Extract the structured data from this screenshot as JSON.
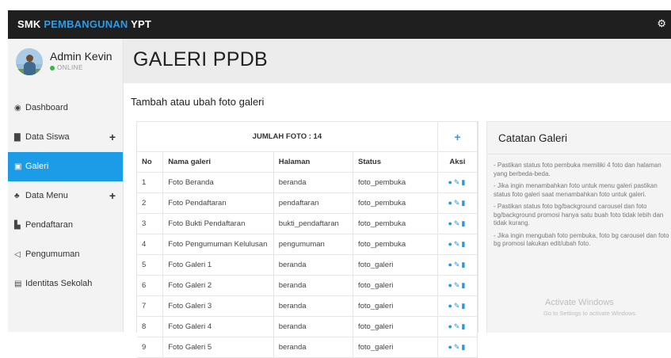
{
  "brand": {
    "part1": "SMK ",
    "part2": "PEMBANGUNAN",
    "part3": " YPT"
  },
  "user": {
    "name": "Admin Kevin",
    "status": "ONLINE"
  },
  "sidebar": {
    "items": [
      {
        "label": "Dashboard",
        "icon": "dashboard-icon",
        "has_plus": false,
        "active": false
      },
      {
        "label": "Data Siswa",
        "icon": "book-icon",
        "has_plus": true,
        "active": false
      },
      {
        "label": "Galeri",
        "icon": "image-icon",
        "has_plus": false,
        "active": true
      },
      {
        "label": "Data Menu",
        "icon": "sitemap-icon",
        "has_plus": true,
        "active": false
      },
      {
        "label": "Pendaftaran",
        "icon": "form-icon",
        "has_plus": false,
        "active": false
      },
      {
        "label": "Pengumuman",
        "icon": "bullhorn-icon",
        "has_plus": false,
        "active": false
      },
      {
        "label": "Identitas Sekolah",
        "icon": "id-card-icon",
        "has_plus": false,
        "active": false
      }
    ]
  },
  "page": {
    "title": "GALERI PPDB",
    "subtitle": "Tambah atau ubah foto galeri"
  },
  "table": {
    "banner": "JUMLAH FOTO : 14",
    "add_symbol": "+",
    "columns": [
      "No",
      "Nama galeri",
      "Halaman",
      "Status",
      "Aksi"
    ],
    "rows": [
      {
        "no": "1",
        "nama": "Foto Beranda",
        "halaman": "beranda",
        "status": "foto_pembuka"
      },
      {
        "no": "2",
        "nama": "Foto Pendaftaran",
        "halaman": "pendaftaran",
        "status": "foto_pembuka"
      },
      {
        "no": "3",
        "nama": "Foto Bukti Pendaftaran",
        "halaman": "bukti_pendaftaran",
        "status": "foto_pembuka"
      },
      {
        "no": "4",
        "nama": "Foto Pengumuman Kelulusan",
        "halaman": "pengumuman",
        "status": "foto_pembuka"
      },
      {
        "no": "5",
        "nama": "Foto Galeri 1",
        "halaman": "beranda",
        "status": "foto_galeri"
      },
      {
        "no": "6",
        "nama": "Foto Galeri 2",
        "halaman": "beranda",
        "status": "foto_galeri"
      },
      {
        "no": "7",
        "nama": "Foto Galeri 3",
        "halaman": "beranda",
        "status": "foto_galeri"
      },
      {
        "no": "8",
        "nama": "Foto Galeri 4",
        "halaman": "beranda",
        "status": "foto_galeri"
      },
      {
        "no": "9",
        "nama": "Foto Galeri 5",
        "halaman": "beranda",
        "status": "foto_galeri"
      }
    ]
  },
  "notes": {
    "title": "Catatan Galeri",
    "items": [
      "- Pastikan status foto pembuka memiliki 4 foto dan halaman yang berbeda-beda.",
      "- Jika ingin menambahkan foto untuk menu galeri pastikan status foto galeri saat menambahkan foto untuk galeri.",
      "- Pastikan status foto bg/background carousel dan foto bg/background promosi hanya satu buah foto tidak lebih dan tidak kurang.",
      "- Jika ingin mengubah foto pembuka, foto bg carousel dan foto bg promosi lakukan edit/ubah foto."
    ]
  },
  "watermark": {
    "line1": "Activate Windows",
    "line2": "Go to Settings to activate Windows."
  },
  "colors": {
    "topbar": "#1f1f1f",
    "accent": "#1c9be6",
    "brand_mid": "#2e9be6",
    "online": "#3bb54a"
  }
}
